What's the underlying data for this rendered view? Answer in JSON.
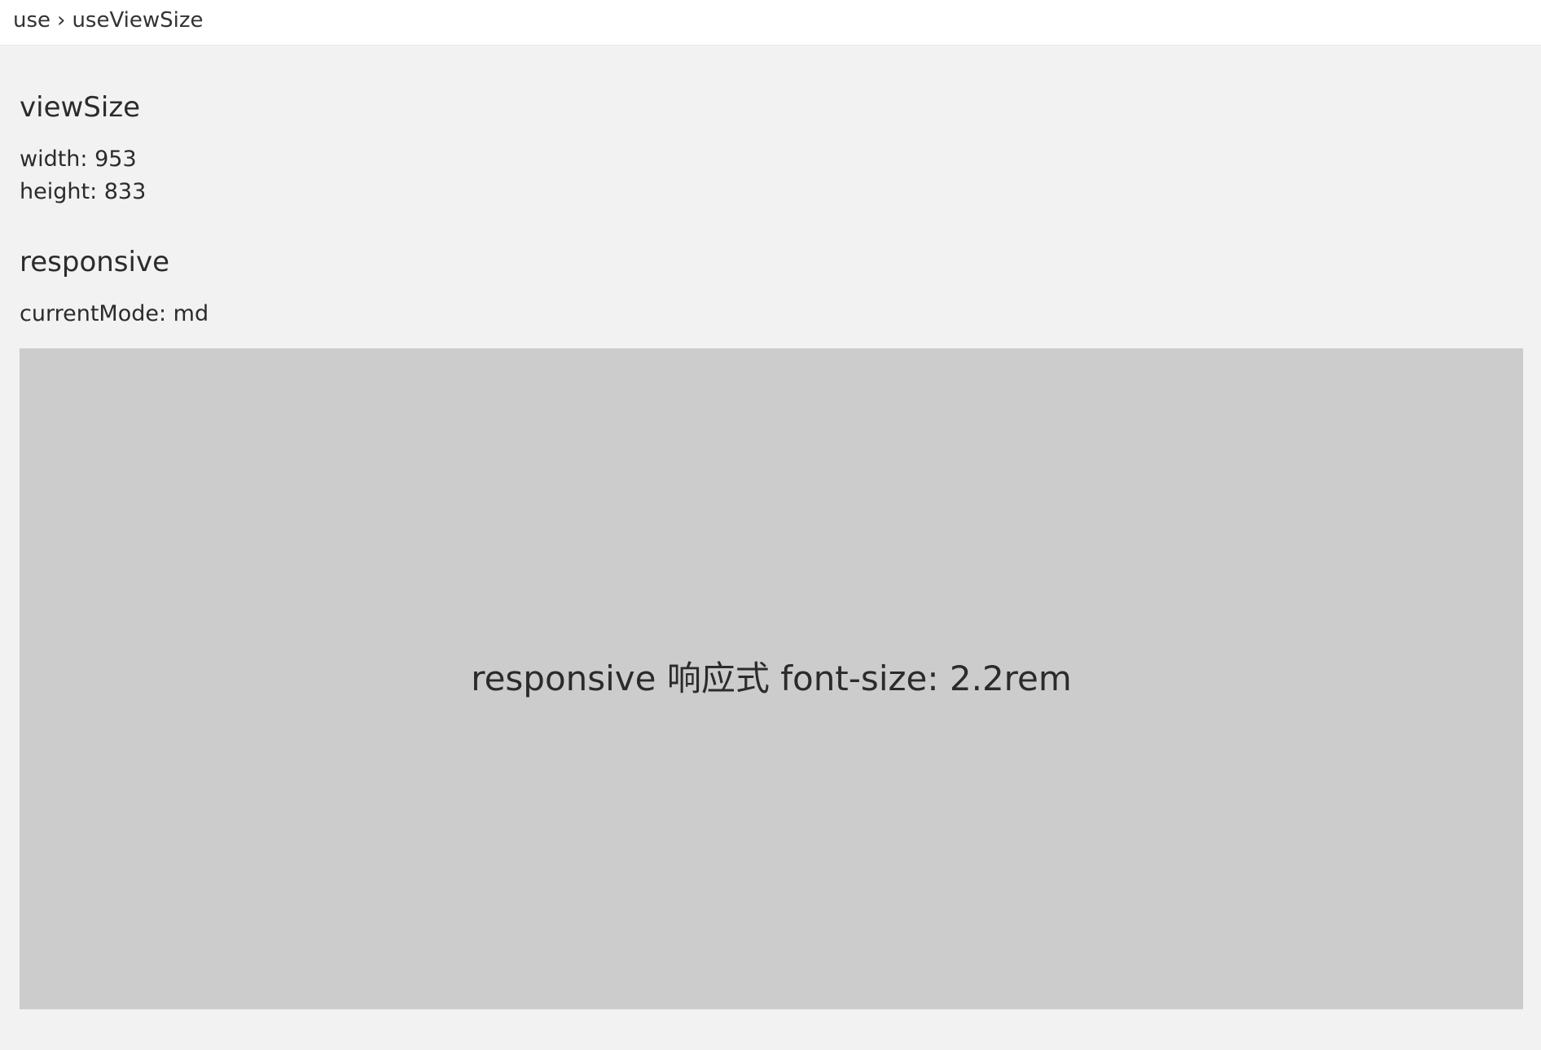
{
  "breadcrumb": {
    "items": [
      "use",
      "useViewSize"
    ],
    "separator": "›"
  },
  "view_size": {
    "title": "viewSize",
    "width_label": "width: 953",
    "height_label": "height: 833"
  },
  "responsive": {
    "title": "responsive",
    "current_mode_label": "currentMode: md",
    "demo_text": "responsive 响应式 font-size: 2.2rem"
  },
  "colors": {
    "page_background": "#f2f2f2",
    "topbar_background": "#ffffff",
    "demo_box_background": "#cccccc",
    "text": "#2b2b2b"
  }
}
